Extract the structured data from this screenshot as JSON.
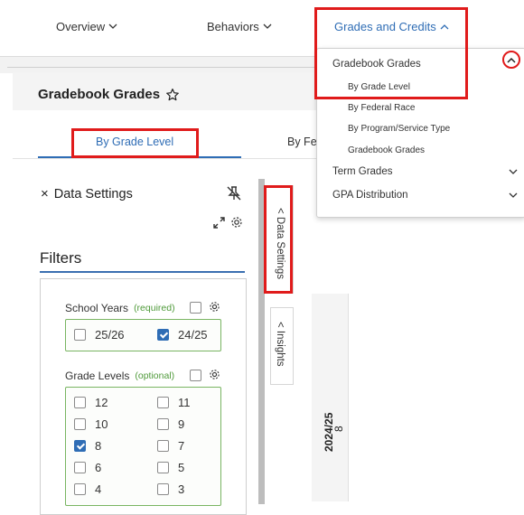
{
  "nav": {
    "overview": "Overview",
    "behaviors": "Behaviors",
    "grades": "Grades and Credits"
  },
  "page": {
    "title": "Gradebook Grades"
  },
  "tabs": {
    "by_grade_level": "By Grade Level",
    "by_federal_partial": "By Fe"
  },
  "data_settings": {
    "title": "Data Settings",
    "filters": "Filters"
  },
  "school_years": {
    "label": "School Years",
    "hint": "(required)",
    "options": [
      {
        "label": "25/26",
        "checked": false
      },
      {
        "label": "24/25",
        "checked": true
      }
    ]
  },
  "grade_levels": {
    "label": "Grade Levels",
    "hint": "(optional)",
    "options": [
      {
        "label": "12",
        "checked": false
      },
      {
        "label": "11",
        "checked": false
      },
      {
        "label": "10",
        "checked": false
      },
      {
        "label": "9",
        "checked": false
      },
      {
        "label": "8",
        "checked": true
      },
      {
        "label": "7",
        "checked": false
      },
      {
        "label": "6",
        "checked": false
      },
      {
        "label": "5",
        "checked": false
      },
      {
        "label": "4",
        "checked": false
      },
      {
        "label": "3",
        "checked": false
      }
    ]
  },
  "side_tabs": {
    "data_settings": "Data Settings",
    "insights": "Insights"
  },
  "chart": {
    "year": "2024/25",
    "grade": "8"
  },
  "dropdown": {
    "gradebook_grades": "Gradebook Grades",
    "items": [
      "By Grade Level",
      "By Federal Race",
      "By Program/Service Type",
      "Gradebook Grades"
    ],
    "term_grades": "Term Grades",
    "gpa_distribution": "GPA Distribution"
  },
  "colors": {
    "accent": "#2f6db5",
    "highlight": "#e01b1b",
    "required_green": "#4f9a3a"
  }
}
